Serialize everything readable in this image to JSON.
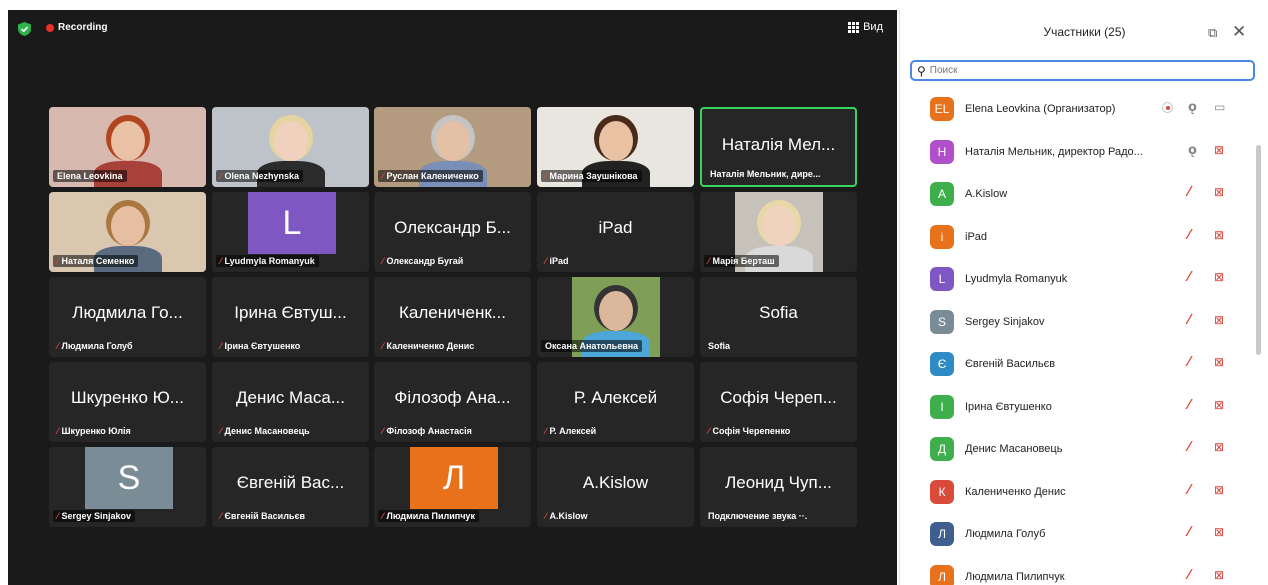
{
  "recording": {
    "label": "Recording"
  },
  "view": {
    "label": "Вид"
  },
  "tiles": [
    {
      "kind": "photo",
      "label": "Elena Leovkina",
      "mic_muted": false
    },
    {
      "kind": "photo",
      "label": "Olena Nezhynska",
      "mic_muted": true
    },
    {
      "kind": "photo",
      "label": "Руслан Калениченко",
      "mic_muted": true
    },
    {
      "kind": "photo",
      "label": "Марина Заушнікова",
      "mic_muted": true
    },
    {
      "kind": "name",
      "big": "Наталія Мел...",
      "label": "Наталія Мельник, дире...",
      "mic_muted": false,
      "active": true
    },
    {
      "kind": "photo",
      "label": "Наталя Семенко",
      "mic_muted": true
    },
    {
      "kind": "avatar",
      "letter": "L",
      "label": "Lyudmyla Romanyuk",
      "mic_muted": true
    },
    {
      "kind": "name",
      "big": "Олександр Б...",
      "label": "Олександр Бугай",
      "mic_muted": true
    },
    {
      "kind": "name",
      "big": "iPad",
      "label": "iPad",
      "mic_muted": true
    },
    {
      "kind": "photo",
      "label": "Марія Берташ",
      "mic_muted": true
    },
    {
      "kind": "name",
      "big": "Людмила Го...",
      "label": "Людмила Голуб",
      "mic_muted": true
    },
    {
      "kind": "name",
      "big": "Ірина Євтуш...",
      "label": "Ірина Євтушенко",
      "mic_muted": true
    },
    {
      "kind": "name",
      "big": "Калениченк...",
      "label": "Калениченко Денис",
      "mic_muted": true
    },
    {
      "kind": "photo",
      "label": "Оксана Анатольевна",
      "mic_muted": false
    },
    {
      "kind": "name",
      "big": "Sofia",
      "label": "Sofia",
      "mic_muted": false
    },
    {
      "kind": "name",
      "big": "Шкуренко Ю...",
      "label": "Шкуренко Юлія",
      "mic_muted": true
    },
    {
      "kind": "name",
      "big": "Денис Маса...",
      "label": "Денис Масановець",
      "mic_muted": true
    },
    {
      "kind": "name",
      "big": "Філозоф Ана...",
      "label": "Філозоф Анастасія",
      "mic_muted": true
    },
    {
      "kind": "name",
      "big": "Р. Алексей",
      "label": "Р. Алексей",
      "mic_muted": true
    },
    {
      "kind": "name",
      "big": "Софія Череп...",
      "label": "Софія Черепенко",
      "mic_muted": true
    },
    {
      "kind": "avatar",
      "letter": "S",
      "label": "Sergey Sinjakov",
      "mic_muted": true
    },
    {
      "kind": "name",
      "big": "Євгеній Вас...",
      "label": "Євгеній Васильєв",
      "mic_muted": true
    },
    {
      "kind": "avatar",
      "letter": "Л",
      "label": "Людмила Пилипчук",
      "mic_muted": true
    },
    {
      "kind": "name",
      "big": "A.Kislow",
      "label": "A.Kislow",
      "mic_muted": true
    },
    {
      "kind": "name",
      "big": "Леонид Чуп...",
      "label": "Подключение звука ··.",
      "mic_muted": false
    }
  ],
  "colors": {
    "avatar_L": "#7e57c2",
    "avatar_S": "#7a8c95",
    "avatar_Л": "#e8721c",
    "active_border": "#3ad35b",
    "muted": "#e0453a"
  },
  "panel": {
    "title": "Участники (25)",
    "search_placeholder": "Поиск",
    "participants": [
      {
        "initials": "EL",
        "color": "#e8721c",
        "name": "Elena Leovkina (Организатор)",
        "host": true,
        "mic_muted": false,
        "cam_off": false
      },
      {
        "initials": "Н",
        "color": "#b04fc9",
        "name": "Наталія Мельник, директор Радо...",
        "mic_muted": false,
        "cam_off": true
      },
      {
        "initials": "A",
        "color": "#3fae4d",
        "name": "A.Kislow",
        "mic_muted": true,
        "cam_off": true
      },
      {
        "initials": "i",
        "color": "#e8721c",
        "name": "iPad",
        "mic_muted": true,
        "cam_off": true
      },
      {
        "initials": "L",
        "color": "#7e57c2",
        "name": "Lyudmyla Romanyuk",
        "mic_muted": true,
        "cam_off": true
      },
      {
        "initials": "S",
        "color": "#7a8c95",
        "name": "Sergey Sinjakov",
        "mic_muted": true,
        "cam_off": true
      },
      {
        "initials": "Є",
        "color": "#2e8bc4",
        "name": "Євгеній Васильєв",
        "mic_muted": true,
        "cam_off": true
      },
      {
        "initials": "І",
        "color": "#3fae4d",
        "name": "Ірина Євтушенко",
        "mic_muted": true,
        "cam_off": true
      },
      {
        "initials": "Д",
        "color": "#3fae4d",
        "name": "Денис Масановець",
        "mic_muted": true,
        "cam_off": true
      },
      {
        "initials": "К",
        "color": "#d84a3a",
        "name": "Калениченко Денис",
        "mic_muted": true,
        "cam_off": true
      },
      {
        "initials": "Л",
        "color": "#3f5f8f",
        "name": "Людмила Голуб",
        "mic_muted": true,
        "cam_off": true
      },
      {
        "initials": "Л",
        "color": "#e8721c",
        "name": "Людмила Пилипчук",
        "mic_muted": true,
        "cam_off": true
      }
    ]
  }
}
